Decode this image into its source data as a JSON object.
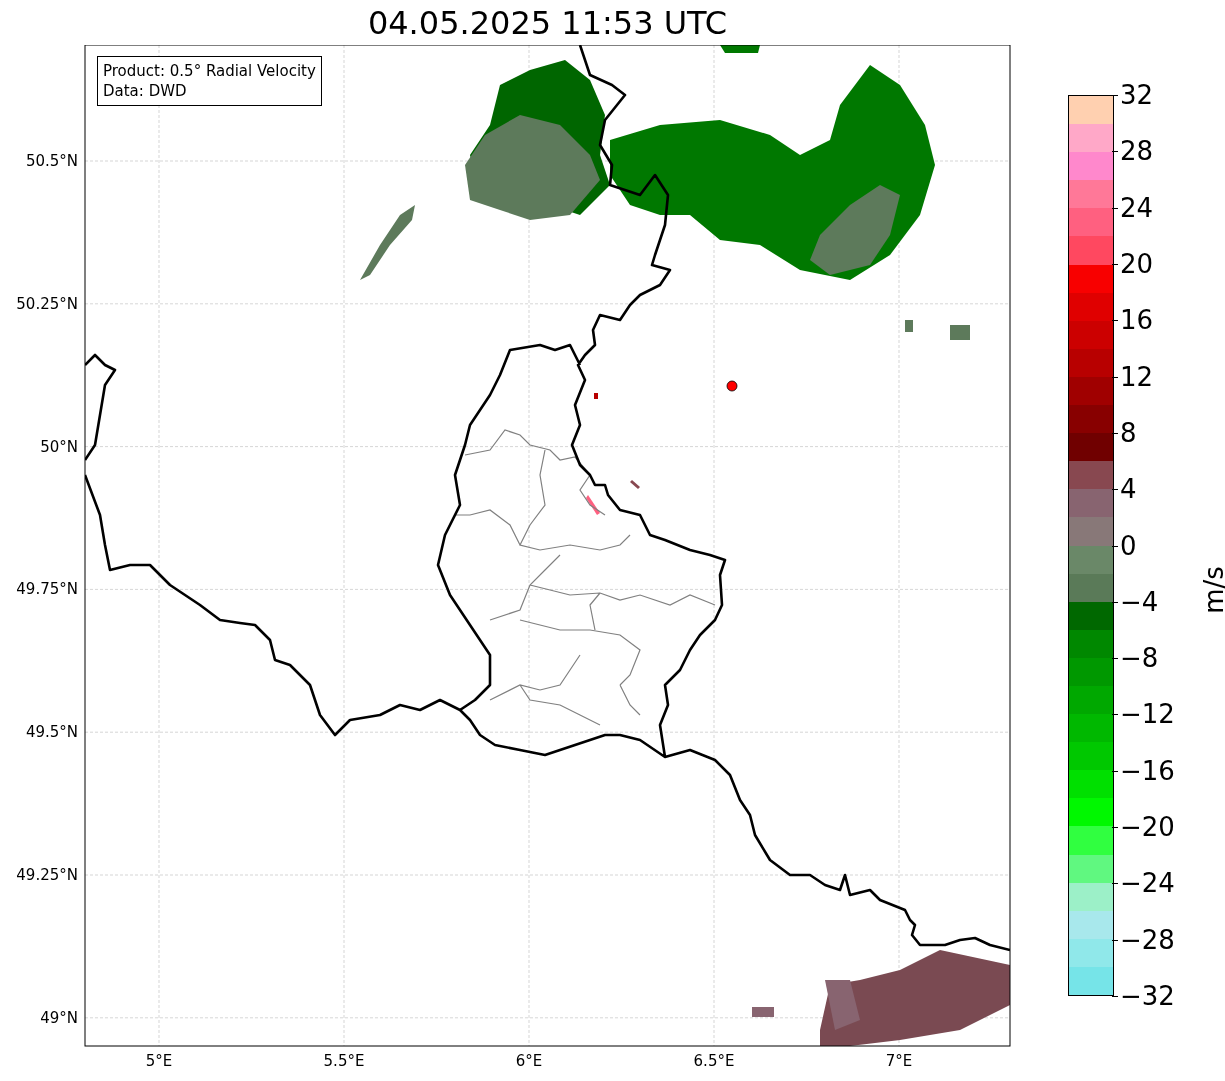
{
  "title": "04.05.2025 11:53 UTC",
  "legend": [
    "Product: 0.5° Radial Velocity",
    "Data: DWD"
  ],
  "map": {
    "x_ticks": [
      "5°E",
      "5.5°E",
      "6°E",
      "6.5°E",
      "7°E"
    ],
    "y_ticks": [
      "50.5°N",
      "50.25°N",
      "50°N",
      "49.75°N",
      "49.5°N",
      "49.25°N",
      "49°N"
    ]
  },
  "colorbar": {
    "label": "m/s",
    "ticks": [
      "32",
      "28",
      "24",
      "20",
      "16",
      "12",
      "8",
      "4",
      "0",
      "−4",
      "−8",
      "−12",
      "−16",
      "−20",
      "−24",
      "−28",
      "−32"
    ],
    "bands": [
      {
        "color": "#ffd0b0"
      },
      {
        "color": "#ffa8c8"
      },
      {
        "color": "#ff88cc"
      },
      {
        "color": "#ff7898"
      },
      {
        "color": "#ff6080"
      },
      {
        "color": "#ff4860"
      },
      {
        "color": "#f80000"
      },
      {
        "color": "#e00000"
      },
      {
        "color": "#cc0000"
      },
      {
        "color": "#b80000"
      },
      {
        "color": "#a00000"
      },
      {
        "color": "#880000"
      },
      {
        "color": "#700000"
      },
      {
        "color": "#884850"
      },
      {
        "color": "#886470"
      },
      {
        "color": "#887878"
      },
      {
        "color": "#6a8868"
      },
      {
        "color": "#5a7a58"
      },
      {
        "color": "#006800"
      },
      {
        "color": "#008800"
      },
      {
        "color": "#009800"
      },
      {
        "color": "#00a800"
      },
      {
        "color": "#00b800"
      },
      {
        "color": "#00c800"
      },
      {
        "color": "#00e000"
      },
      {
        "color": "#00f800"
      },
      {
        "color": "#30ff40"
      },
      {
        "color": "#60f880"
      },
      {
        "color": "#9cf0c8"
      },
      {
        "color": "#a8e8ec"
      },
      {
        "color": "#90e8ea"
      },
      {
        "color": "#76e4e8"
      }
    ]
  }
}
